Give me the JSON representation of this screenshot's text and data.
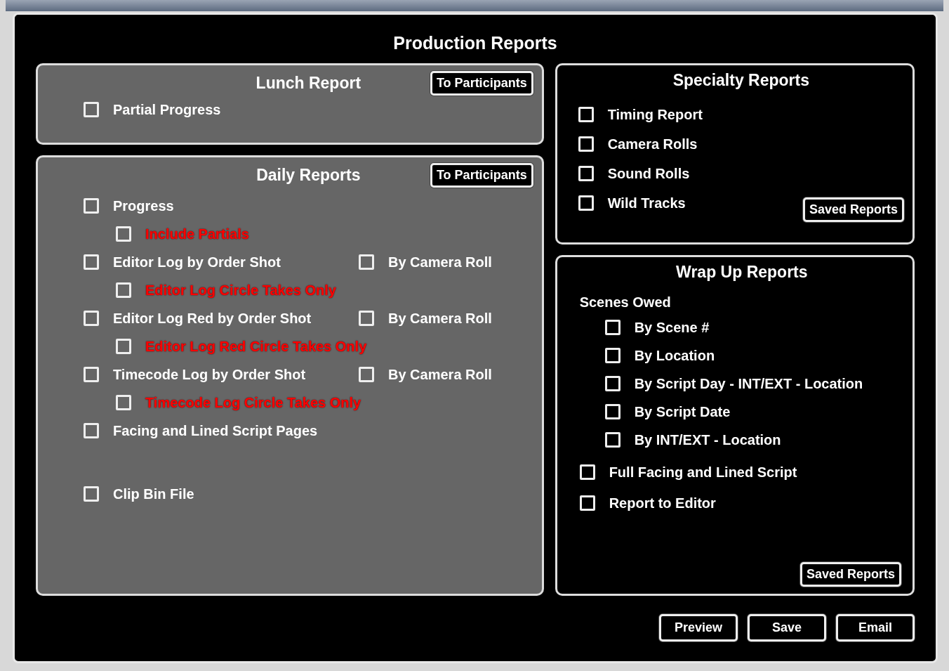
{
  "title": "Production Reports",
  "lunch": {
    "title": "Lunch Report",
    "button": "To Participants",
    "items": [
      {
        "label": "Partial Progress",
        "checked": false
      }
    ]
  },
  "daily": {
    "title": "Daily Reports",
    "button": "To Participants",
    "items": [
      {
        "label": "Progress",
        "checked": false,
        "children": [
          {
            "label": "Include Partials",
            "checked": false,
            "kind": "option"
          }
        ]
      },
      {
        "label": "Editor Log by Order Shot",
        "checked": false,
        "alt": {
          "label": "By Camera Roll",
          "checked": false
        },
        "children": [
          {
            "label": "Editor Log Circle Takes Only",
            "checked": false,
            "kind": "option"
          }
        ]
      },
      {
        "label": "Editor Log Red by Order Shot",
        "checked": false,
        "alt": {
          "label": "By Camera Roll",
          "checked": false
        },
        "children": [
          {
            "label": "Editor Log Red Circle Takes Only",
            "checked": false,
            "kind": "option"
          }
        ]
      },
      {
        "label": "Timecode Log by Order Shot",
        "checked": false,
        "alt": {
          "label": "By Camera Roll",
          "checked": false
        },
        "children": [
          {
            "label": "Timecode Log Circle Takes Only",
            "checked": false,
            "kind": "option"
          }
        ]
      },
      {
        "label": "Facing and Lined Script Pages",
        "checked": false
      }
    ],
    "extra_items": [
      {
        "label": "Clip Bin File",
        "checked": false
      }
    ]
  },
  "specialty": {
    "title": "Specialty Reports",
    "items": [
      {
        "label": "Timing Report",
        "checked": false
      },
      {
        "label": "Camera Rolls",
        "checked": false
      },
      {
        "label": "Sound Rolls",
        "checked": false
      },
      {
        "label": "Wild Tracks",
        "checked": false
      }
    ],
    "button": "Saved Reports"
  },
  "wrap_up": {
    "title": "Wrap Up Reports",
    "group_label": "Scenes Owed",
    "group_items": [
      {
        "label": "By Scene #",
        "checked": false
      },
      {
        "label": "By Location",
        "checked": false
      },
      {
        "label": "By Script Day - INT/EXT - Location",
        "checked": false
      },
      {
        "label": "By Script Date",
        "checked": false
      },
      {
        "label": "By INT/EXT - Location",
        "checked": false
      }
    ],
    "items": [
      {
        "label": "Full Facing and Lined Script",
        "checked": false
      },
      {
        "label": "Report to Editor",
        "checked": false
      }
    ],
    "button": "Saved Reports"
  },
  "buttons": [
    "Preview",
    "Save",
    "Email"
  ]
}
